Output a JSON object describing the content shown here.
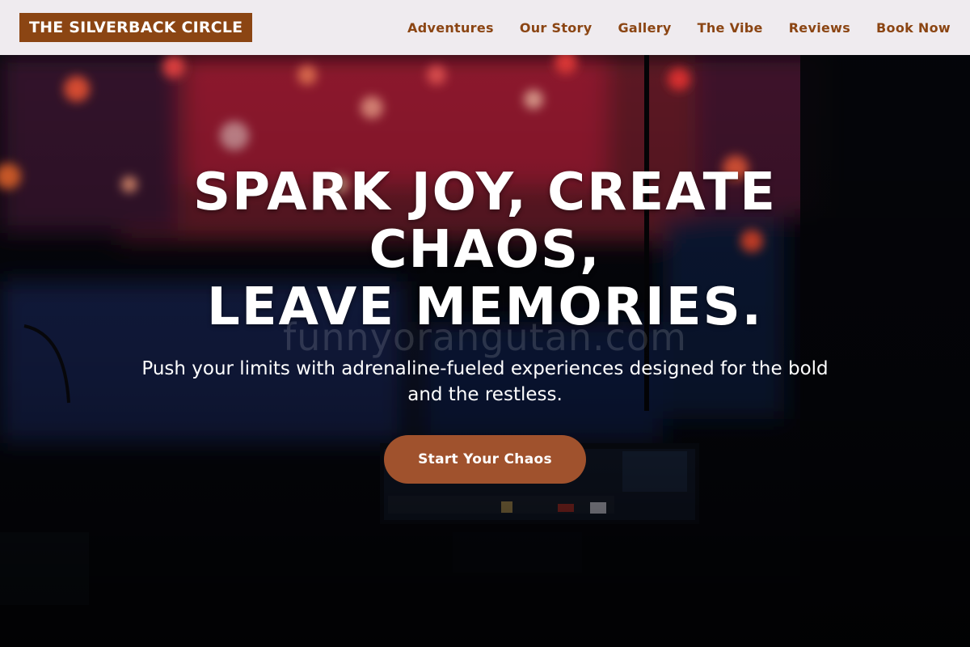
{
  "header": {
    "logo": "THE SILVERBACK CIRCLE",
    "nav": [
      "Adventures",
      "Our Story",
      "Gallery",
      "The Vibe",
      "Reviews",
      "Book Now"
    ]
  },
  "hero": {
    "background_description_icon": "concert-stage-photo",
    "watermark": "funnyorangutan.com",
    "headline_lines": [
      "SPARK JOY, CREATE",
      "CHAOS,",
      "LEAVE MEMORIES."
    ],
    "subtitle": "Push your limits with adrenaline-fueled experiences designed for the bold and the restless.",
    "cta_label": "Start Your Chaos"
  },
  "colors": {
    "brand": "#8b4513",
    "cta": "#a0522d",
    "header_bg": "#efebef",
    "hero_bg": "#06070d"
  }
}
